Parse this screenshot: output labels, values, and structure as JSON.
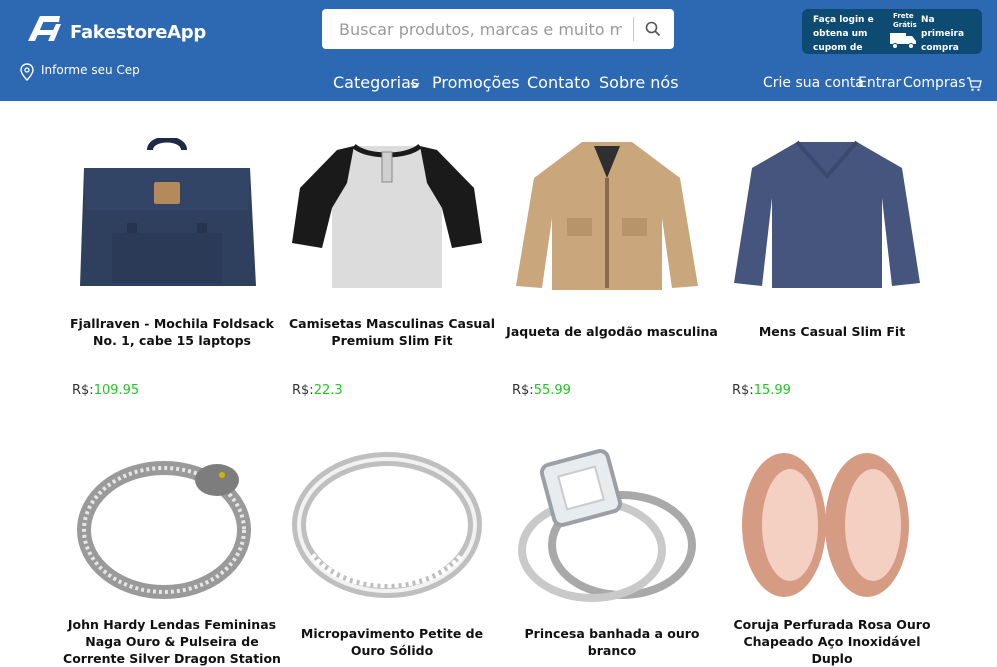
{
  "brand": {
    "name": "FakestoreApp"
  },
  "search": {
    "placeholder": "Buscar produtos, marcas e muito mais..."
  },
  "promo": {
    "left_text": "Faça login e obtena um cupom de",
    "badge": "Frete Grátis",
    "right_text": "Na primeira compra"
  },
  "location": {
    "label": "Informe seu Cep"
  },
  "nav": {
    "categorias": "Categorias",
    "promocoes": "Promoções",
    "contato": "Contato",
    "sobre": "Sobre nós"
  },
  "account": {
    "create": "Crie sua conta",
    "login": "Entrar",
    "purchases": "Compras"
  },
  "currency": "R$:",
  "products": [
    {
      "title": "Fjallraven - Mochila Foldsack No. 1, cabe 15 laptops",
      "price": "109.95",
      "image": "backpack"
    },
    {
      "title": "Camisetas Masculinas Casual Premium Slim Fit",
      "price": "22.3",
      "image": "raglan-tshirt"
    },
    {
      "title": "Jaqueta de algodão masculina",
      "price": "55.99",
      "image": "cotton-jacket"
    },
    {
      "title": "Mens Casual Slim Fit",
      "price": "15.99",
      "image": "longsleeve-shirt"
    },
    {
      "title": "John Hardy Lendas Femininas Naga Ouro & Pulseira de Corrente Silver Dragon Station",
      "image": "dragon-bracelet"
    },
    {
      "title": "Micropavimento Petite de Ouro Sólido",
      "image": "pave-ring"
    },
    {
      "title": "Princesa banhada a ouro branco",
      "image": "princess-ring-set"
    },
    {
      "title": "Coruja Perfurada Rosa Ouro Chapeado Aço Inoxidável Duplo",
      "image": "rose-gold-plugs"
    }
  ],
  "colors": {
    "header": "#2d68b3",
    "promo": "#0e4b72",
    "price": "#27c227"
  }
}
